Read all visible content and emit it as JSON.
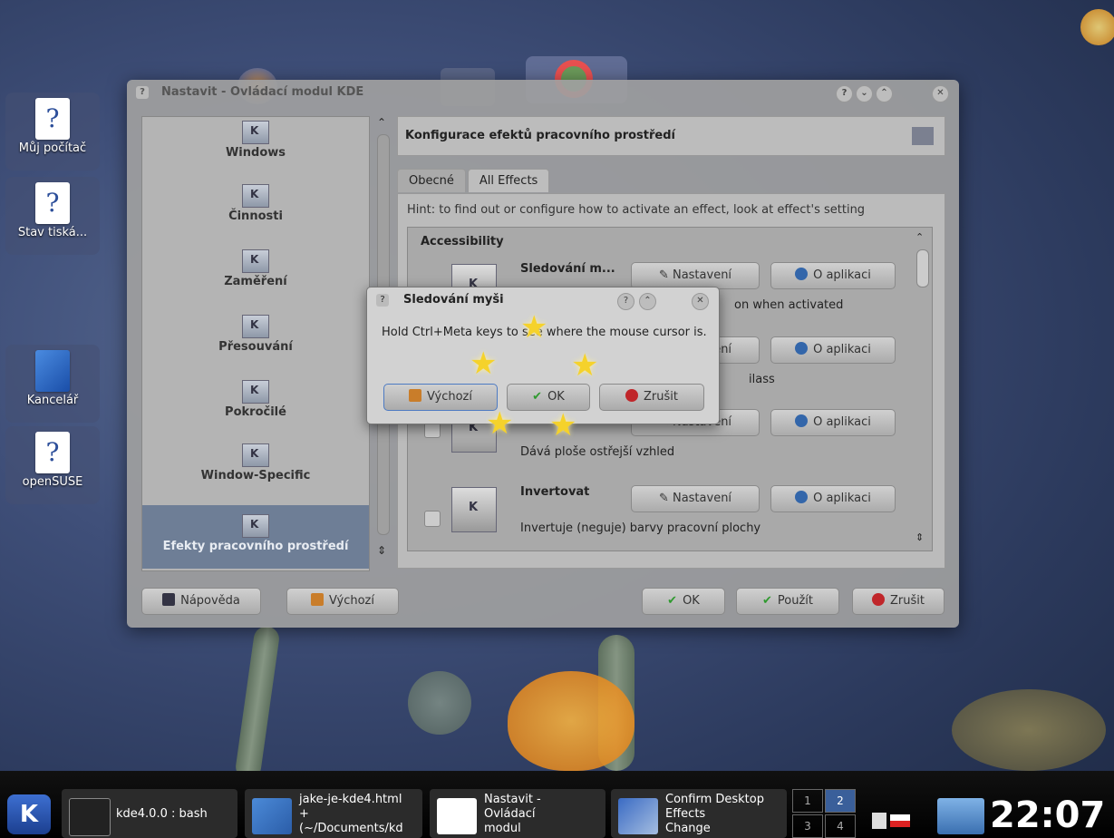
{
  "desktop": {
    "icons": [
      {
        "label": "Můj počítač"
      },
      {
        "label": "Stav tiská..."
      },
      {
        "label": "Kancelář"
      },
      {
        "label": "openSUSE"
      }
    ]
  },
  "window": {
    "title": "Nastavit - Ovládací modul KDE",
    "sidebar": [
      {
        "label": "Windows"
      },
      {
        "label": "Činnosti"
      },
      {
        "label": "Zaměření"
      },
      {
        "label": "Přesouvání"
      },
      {
        "label": "Pokročilé"
      },
      {
        "label": "Window-Specific"
      },
      {
        "label": "Efekty pracovního prostředí"
      }
    ],
    "header": "Konfigurace efektů pracovního prostředí",
    "tabs": [
      "Obecné",
      "All Effects"
    ],
    "hint": "Hint: to find out or configure how to activate an effect, look at effect's setting",
    "category": "Accessibility",
    "effects": [
      {
        "name": "Sledování m...",
        "desc": "on when activated"
      },
      {
        "name": "",
        "desc": "ilass"
      },
      {
        "name": "",
        "desc": "Dává ploše ostřejší vzhled"
      },
      {
        "name": "Invertovat",
        "desc": "Invertuje (neguje) barvy pracovní plochy"
      }
    ],
    "effect_buttons": {
      "settings": "Nastavení",
      "about": "O aplikaci"
    },
    "buttons": {
      "help": "Nápověda",
      "defaults": "Výchozí",
      "ok": "OK",
      "apply": "Použít",
      "cancel": "Zrušit"
    }
  },
  "dialog": {
    "title": "Sledování myši",
    "message": "Hold Ctrl+Meta keys to see where the mouse cursor is.",
    "buttons": {
      "defaults": "Výchozí",
      "ok": "OK",
      "cancel": "Zrušit"
    }
  },
  "taskbar": {
    "tasks": [
      {
        "label": "kde4.0.0 : bash"
      },
      {
        "label": "jake-je-kde4.html\n+\n(~/Documents/kd"
      },
      {
        "label": "Nastavit -\nOvládací\nmodul"
      },
      {
        "label": "Confirm Desktop\nEffects\nChange"
      }
    ],
    "pager": [
      "1",
      "2",
      "3",
      "4"
    ],
    "clock": "22:07"
  },
  "colors": {
    "ok_green": "#2f9a2f",
    "cancel_red": "#c0262a",
    "info_blue": "#3366aa"
  }
}
